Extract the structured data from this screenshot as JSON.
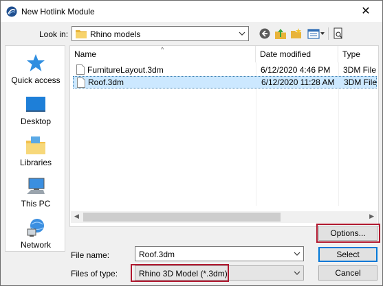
{
  "window": {
    "title": "New Hotlink Module",
    "close_glyph": "✕"
  },
  "toolbar": {
    "look_in_label": "Look in:",
    "look_in_value": "Rhino models",
    "icons": [
      "back-icon",
      "up-folder-icon",
      "new-folder-icon",
      "view-menu-icon",
      "preview-icon"
    ]
  },
  "places": [
    {
      "label": "Quick access",
      "icon": "star-icon"
    },
    {
      "label": "Desktop",
      "icon": "desktop-icon"
    },
    {
      "label": "Libraries",
      "icon": "libraries-icon"
    },
    {
      "label": "This PC",
      "icon": "computer-icon"
    },
    {
      "label": "Network",
      "icon": "network-icon"
    }
  ],
  "file_list": {
    "columns": [
      "Name",
      "Date modified",
      "Type"
    ],
    "sort_indicator": "^",
    "rows": [
      {
        "name": "FurnitureLayout.3dm",
        "date": "6/12/2020 4:46 PM",
        "type": "3DM File",
        "selected": false
      },
      {
        "name": "Roof.3dm",
        "date": "6/12/2020 11:28 AM",
        "type": "3DM File",
        "selected": true
      }
    ]
  },
  "form": {
    "file_name_label": "File name:",
    "file_name_value": "Roof.3dm",
    "file_type_label": "Files of type:",
    "file_type_value": "Rhino 3D Model (*.3dm)"
  },
  "buttons": {
    "options": "Options...",
    "select": "Select",
    "cancel": "Cancel"
  },
  "colors": {
    "highlight_box": "#b0172e",
    "selection": "#cce8ff",
    "accent": "#0078d7"
  }
}
